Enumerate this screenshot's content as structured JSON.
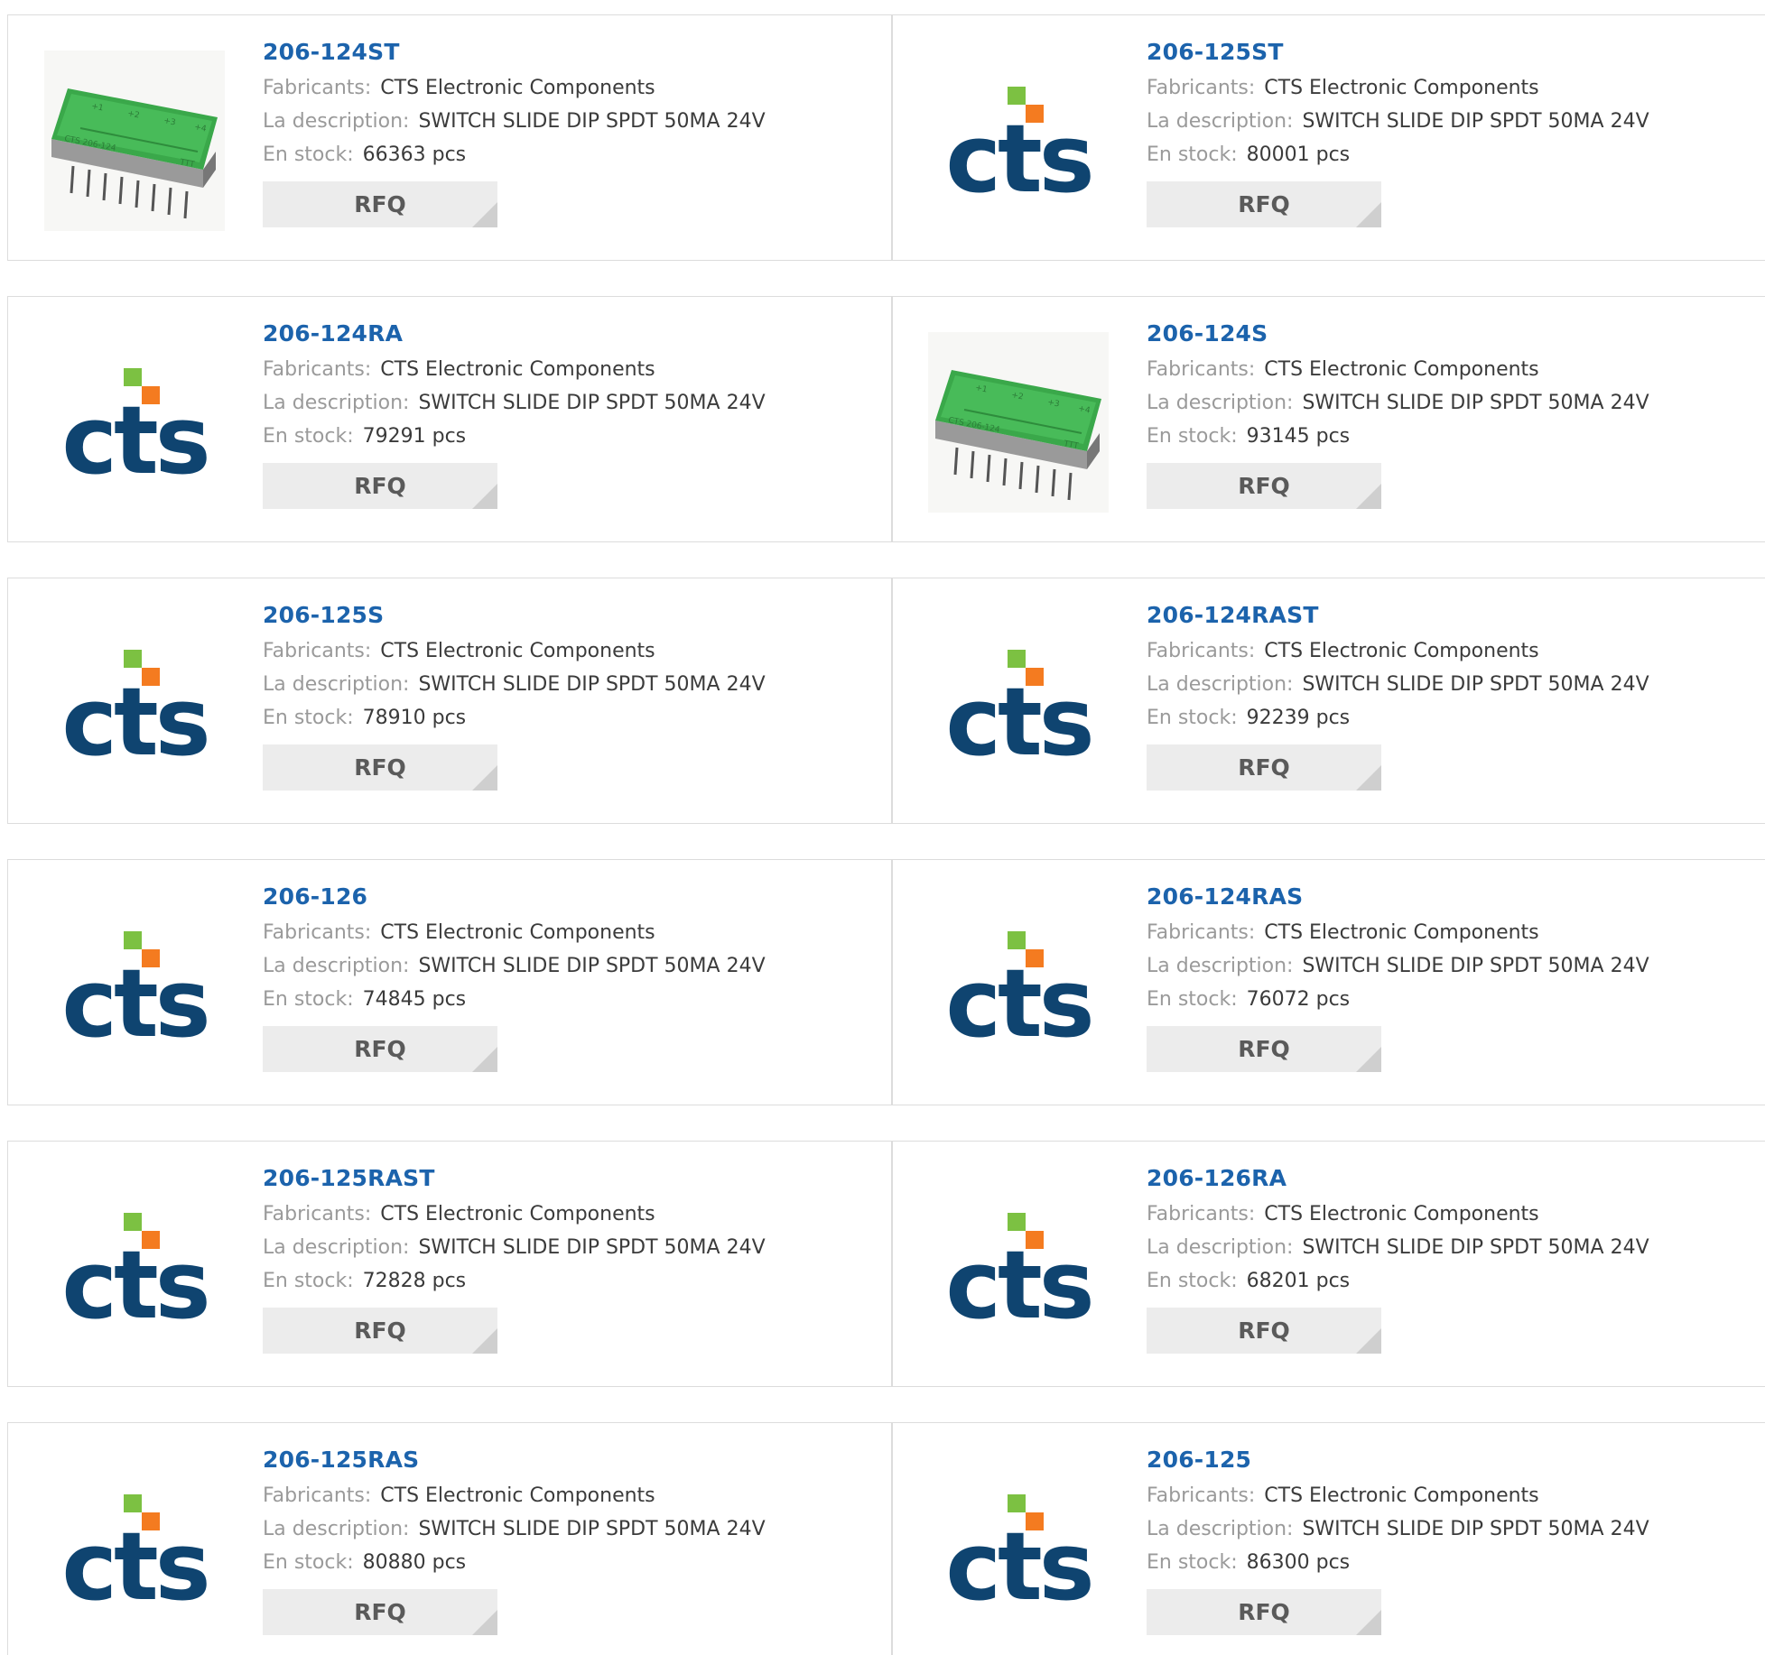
{
  "labels": {
    "manufacturer": "Fabricants:",
    "description": "La description:",
    "stock": "En stock:"
  },
  "products": [
    {
      "part": "206-124ST",
      "manufacturer": "CTS Electronic Components",
      "description": "SWITCH SLIDE DIP SPDT 50MA 24V",
      "stock": "66363 pcs",
      "rfq": "RFQ",
      "image": "switch-photo"
    },
    {
      "part": "206-125ST",
      "manufacturer": "CTS Electronic Components",
      "description": "SWITCH SLIDE DIP SPDT 50MA 24V",
      "stock": "80001 pcs",
      "rfq": "RFQ",
      "image": "cts-logo"
    },
    {
      "part": "206-124RA",
      "manufacturer": "CTS Electronic Components",
      "description": "SWITCH SLIDE DIP SPDT 50MA 24V",
      "stock": "79291 pcs",
      "rfq": "RFQ",
      "image": "cts-logo"
    },
    {
      "part": "206-124S",
      "manufacturer": "CTS Electronic Components",
      "description": "SWITCH SLIDE DIP SPDT 50MA 24V",
      "stock": "93145 pcs",
      "rfq": "RFQ",
      "image": "switch-photo"
    },
    {
      "part": "206-125S",
      "manufacturer": "CTS Electronic Components",
      "description": "SWITCH SLIDE DIP SPDT 50MA 24V",
      "stock": "78910 pcs",
      "rfq": "RFQ",
      "image": "cts-logo"
    },
    {
      "part": "206-124RAST",
      "manufacturer": "CTS Electronic Components",
      "description": "SWITCH SLIDE DIP SPDT 50MA 24V",
      "stock": "92239 pcs",
      "rfq": "RFQ",
      "image": "cts-logo"
    },
    {
      "part": "206-126",
      "manufacturer": "CTS Electronic Components",
      "description": "SWITCH SLIDE DIP SPDT 50MA 24V",
      "stock": "74845 pcs",
      "rfq": "RFQ",
      "image": "cts-logo"
    },
    {
      "part": "206-124RAS",
      "manufacturer": "CTS Electronic Components",
      "description": "SWITCH SLIDE DIP SPDT 50MA 24V",
      "stock": "76072 pcs",
      "rfq": "RFQ",
      "image": "cts-logo"
    },
    {
      "part": "206-125RAST",
      "manufacturer": "CTS Electronic Components",
      "description": "SWITCH SLIDE DIP SPDT 50MA 24V",
      "stock": "72828 pcs",
      "rfq": "RFQ",
      "image": "cts-logo"
    },
    {
      "part": "206-126RA",
      "manufacturer": "CTS Electronic Components",
      "description": "SWITCH SLIDE DIP SPDT 50MA 24V",
      "stock": "68201 pcs",
      "rfq": "RFQ",
      "image": "cts-logo"
    },
    {
      "part": "206-125RAS",
      "manufacturer": "CTS Electronic Components",
      "description": "SWITCH SLIDE DIP SPDT 50MA 24V",
      "stock": "80880 pcs",
      "rfq": "RFQ",
      "image": "cts-logo"
    },
    {
      "part": "206-125",
      "manufacturer": "CTS Electronic Components",
      "description": "SWITCH SLIDE DIP SPDT 50MA 24V",
      "stock": "86300 pcs",
      "rfq": "RFQ",
      "image": "cts-logo"
    }
  ],
  "colors": {
    "part_link": "#1c63ac",
    "logo_navy": "#0f4470",
    "logo_green": "#7cc142",
    "logo_orange": "#f47b20",
    "button_bg": "#ececec"
  }
}
